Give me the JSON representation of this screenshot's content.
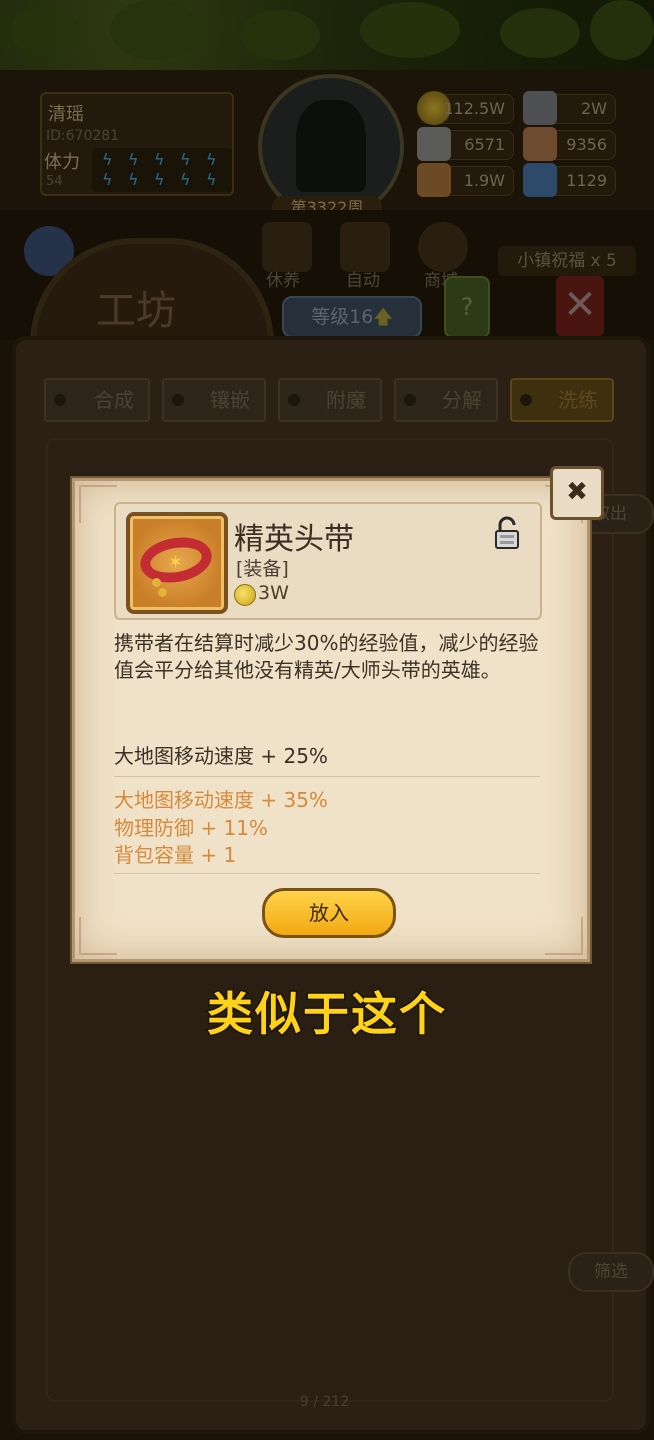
{
  "player": {
    "name": "清瑶",
    "id": "ID:670281",
    "stamina_label": "体力",
    "stamina_value": "54",
    "week": "第3322周"
  },
  "resources": [
    {
      "icon": "gold-coin-icon",
      "value": "112.5W"
    },
    {
      "icon": "iron-ingot-icon",
      "value": "2W"
    },
    {
      "icon": "stone-icon",
      "value": "6571"
    },
    {
      "icon": "leather-icon",
      "value": "9356"
    },
    {
      "icon": "wood-icon",
      "value": "1.9W"
    },
    {
      "icon": "crystal-icon",
      "value": "1129"
    }
  ],
  "nav": {
    "workshop_title": "工坊",
    "cultivate": "休养",
    "auto": "自动",
    "shop": "商城",
    "level": "等级16",
    "help": "?",
    "town_bless": "小镇祝福 x 5"
  },
  "tabs": [
    {
      "label": "合成"
    },
    {
      "label": "镶嵌"
    },
    {
      "label": "附魔"
    },
    {
      "label": "分解"
    },
    {
      "label": "洗练"
    }
  ],
  "side": {
    "take_out": "取出",
    "filter": "筛选"
  },
  "pager": "9 / 212",
  "modal": {
    "item_name": "精英头带",
    "item_type": "[装备]",
    "item_price": "3W",
    "description": "携带者在结算时减少30%的经验值，减少的经验值会平分给其他没有精英/大师头带的英雄。",
    "base_stat": "大地图移动速度 + 25%",
    "extra_stats": [
      "大地图移动速度 + 35%",
      "物理防御 + 11%",
      "背包容量 + 1"
    ],
    "put_button": "放入",
    "accent_color": "#d58a3c"
  },
  "caption": "类似于这个"
}
